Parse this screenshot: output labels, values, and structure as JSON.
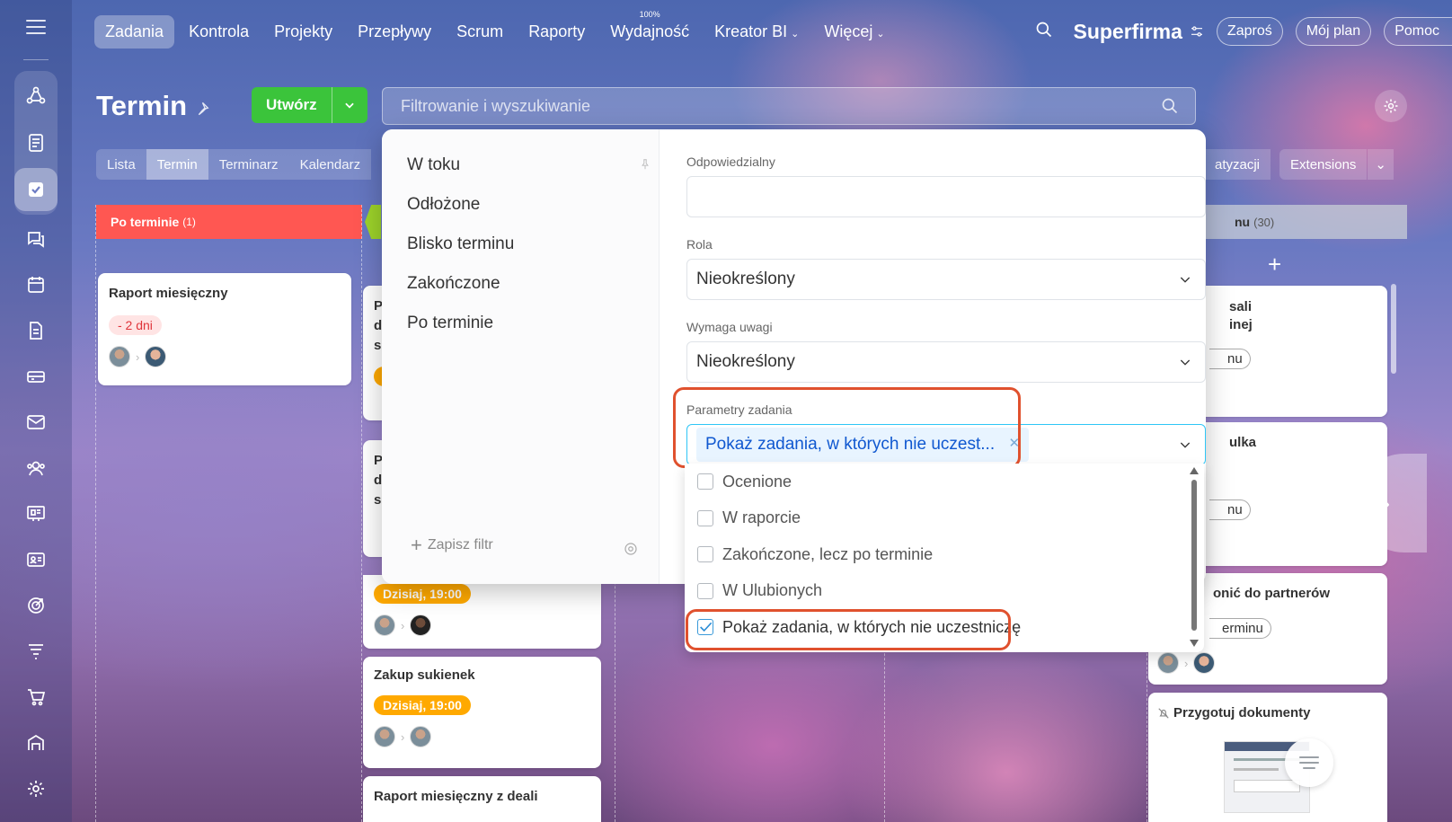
{
  "nav": {
    "items": [
      {
        "label": "Zadania",
        "active": true
      },
      {
        "label": "Kontrola"
      },
      {
        "label": "Projekty"
      },
      {
        "label": "Przepływy"
      },
      {
        "label": "Scrum"
      },
      {
        "label": "Raporty"
      },
      {
        "label": "Wydajność",
        "badge": "100%"
      },
      {
        "label": "Kreator BI",
        "dropdown": true
      },
      {
        "label": "Więcej",
        "dropdown": true
      }
    ],
    "brand": "Superfirma",
    "invite": "Zaproś",
    "my_plan": "Mój plan",
    "help": "Pomoc"
  },
  "sidebar": {
    "icons": [
      "hamburger-icon",
      "flow-icon",
      "feed-icon",
      "tasks-icon",
      "chat-icon",
      "calendar-icon",
      "documents-icon",
      "crm-icon",
      "mail-icon",
      "contacts-icon",
      "board-icon",
      "workgroups-icon",
      "targets-icon",
      "filter-icon",
      "shop-icon",
      "inventory-icon",
      "settings-icon"
    ]
  },
  "header": {
    "title": "Termin",
    "create": "Utwórz",
    "search_placeholder": "Filtrowanie i wyszukiwanie"
  },
  "view_tabs": [
    {
      "label": "Lista"
    },
    {
      "label": "Termin",
      "active": true
    },
    {
      "label": "Terminarz"
    },
    {
      "label": "Kalendarz"
    }
  ],
  "right_tabs": {
    "partial": "atyzacji",
    "extensions": "Extensions"
  },
  "columns": {
    "overdue": {
      "label": "Po terminie",
      "count": "(1)"
    },
    "right": {
      "label": "nu",
      "count": "(30)"
    }
  },
  "cards": {
    "c1": {
      "title": "Raport miesięczny",
      "deadline": "- 2 dni"
    },
    "c2": {
      "partial_lines": [
        "P",
        "d",
        "s"
      ]
    },
    "c3": {
      "partial_lines": [
        "P",
        "d",
        "s"
      ]
    },
    "c4": {
      "deadline": "Dzisiaj, 19:00"
    },
    "c5": {
      "title": "Zakup sukienek",
      "deadline": "Dzisiaj, 19:00"
    },
    "c6": {
      "title": "Raport miesięczny z deali"
    }
  },
  "right_cards": {
    "r1": {
      "line1": "sali",
      "line2": "inej",
      "status": "nu"
    },
    "r2": {
      "line1": "ulka",
      "status": "nu"
    },
    "r3": {
      "title": "onić do partnerów",
      "status": "erminu"
    },
    "r4": {
      "title": "Przygotuj dokumenty"
    }
  },
  "filter_popup": {
    "presets": [
      "W toku",
      "Odłożone",
      "Blisko terminu",
      "Zakończone",
      "Po terminie"
    ],
    "save_filter": "Zapisz filtr",
    "fields": {
      "responsible": {
        "label": "Odpowiedzialny",
        "value": ""
      },
      "role": {
        "label": "Rola",
        "value": "Nieokreślony"
      },
      "attention": {
        "label": "Wymaga uwagi",
        "value": "Nieokreślony"
      },
      "task_params": {
        "label": "Parametry zadania",
        "tag": "Pokaż zadania, w których nie uczest..."
      }
    },
    "options": [
      {
        "label": "Ocenione",
        "checked": false
      },
      {
        "label": "W raporcie",
        "checked": false
      },
      {
        "label": "Zakończone, lecz po terminie",
        "checked": false
      },
      {
        "label": "W Ulubionych",
        "checked": false
      },
      {
        "label": "Pokaż zadania, w których nie uczestniczę",
        "checked": true
      }
    ]
  },
  "colors": {
    "accent_green": "#3bc43b",
    "overdue_red": "#ff5752",
    "deadline_orange": "#ffa900",
    "highlight": "#e0512e",
    "tag_blue": "#1058d0"
  }
}
